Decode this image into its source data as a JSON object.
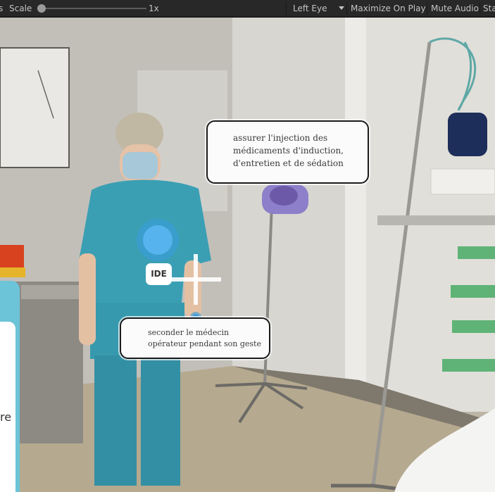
{
  "toolbar": {
    "clipped_prefix": "s",
    "scale_label": "Scale",
    "scale_value": 0.0,
    "scale_value_label": "1x",
    "eye_dropdown": "Left Eye",
    "maximize_on_play": "Maximize On Play",
    "mute_audio": "Mute Audio",
    "stats_clipped": "Sta"
  },
  "scene": {
    "bubble_top": {
      "lines": [
        "assurer l'injection des",
        "médicaments d'induction,",
        "d'entretien et de sédation"
      ]
    },
    "ide_badge": "IDE",
    "bubble_bottom": {
      "lines": [
        "seconder le médecin",
        "opérateur pendant son geste"
      ]
    },
    "side_card_text": "re"
  },
  "colors": {
    "toolbar_bg": "#282828",
    "accent_blue": "#3a9de0",
    "side_card": "#6cc4d9",
    "scrub": "#3b9ad9"
  }
}
